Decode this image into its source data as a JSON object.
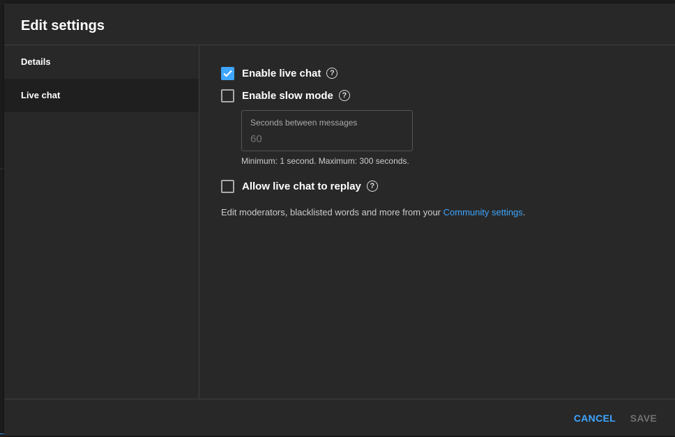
{
  "dialog": {
    "title": "Edit settings"
  },
  "sidebar": {
    "items": [
      {
        "label": "Details",
        "active": false
      },
      {
        "label": "Live chat",
        "active": true
      }
    ]
  },
  "live_chat": {
    "enable_live_chat": {
      "label": "Enable live chat",
      "checked": true,
      "help_icon": "help-circle-icon"
    },
    "enable_slow_mode": {
      "label": "Enable slow mode",
      "checked": false,
      "help_icon": "help-circle-icon"
    },
    "seconds_field": {
      "label": "Seconds between messages",
      "placeholder": "60",
      "value": ""
    },
    "seconds_hint": "Minimum: 1 second. Maximum: 300 seconds.",
    "allow_replay": {
      "label": "Allow live chat to replay",
      "checked": false,
      "help_icon": "help-circle-icon"
    },
    "footnote_prefix": "Edit moderators, blacklisted words and more from your ",
    "footnote_link": "Community settings",
    "footnote_suffix": "."
  },
  "footer": {
    "cancel_label": "CANCEL",
    "save_label": "SAVE"
  },
  "colors": {
    "accent": "#3ea6ff",
    "dialog_bg": "#282828",
    "disabled_text": "#717171"
  }
}
